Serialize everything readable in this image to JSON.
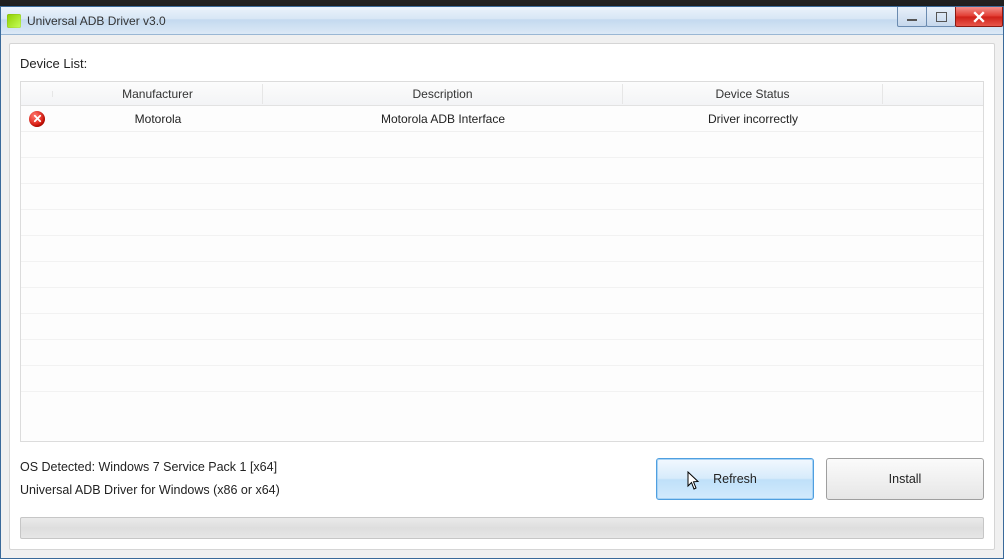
{
  "window": {
    "title": "Universal ADB Driver v3.0"
  },
  "main": {
    "list_label": "Device List:",
    "columns": {
      "manufacturer": "Manufacturer",
      "description": "Description",
      "status": "Device Status"
    },
    "rows": [
      {
        "icon": "error",
        "manufacturer": "Motorola",
        "description": "Motorola ADB Interface",
        "status": "Driver incorrectly"
      }
    ]
  },
  "footer": {
    "os_detected": "OS Detected: Windows 7 Service Pack 1 [x64]",
    "driver_info": "Universal ADB Driver for Windows (x86 or x64)",
    "refresh_label": "Refresh",
    "install_label": "Install"
  }
}
